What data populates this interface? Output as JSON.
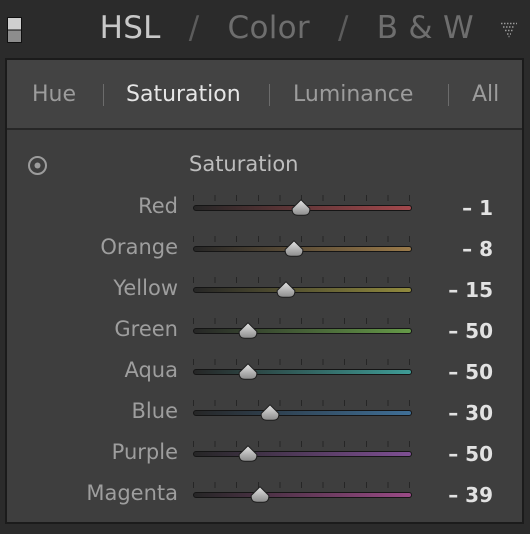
{
  "header": {
    "panel_switch_icon": "panel-switch-icon",
    "tabs": [
      "HSL",
      "Color",
      "B & W"
    ],
    "separator": "/",
    "collapse_icon": "triangle-down-icon"
  },
  "subtabs": [
    "Hue",
    "Saturation",
    "Luminance",
    "All"
  ],
  "active_subtab": "Saturation",
  "section": {
    "title": "Saturation",
    "target_icon": "targeted-adjustment-icon"
  },
  "sliders": [
    {
      "label": "Red",
      "value_text": "– 1",
      "value": -1,
      "color": "#a3484c"
    },
    {
      "label": "Orange",
      "value_text": "– 8",
      "value": -8,
      "color": "#9a7a4a"
    },
    {
      "label": "Yellow",
      "value_text": "– 15",
      "value": -15,
      "color": "#918a3e"
    },
    {
      "label": "Green",
      "value_text": "– 50",
      "value": -50,
      "color": "#659a48"
    },
    {
      "label": "Aqua",
      "value_text": "– 50",
      "value": -50,
      "color": "#3e9c96"
    },
    {
      "label": "Blue",
      "value_text": "– 30",
      "value": -30,
      "color": "#3f6f97"
    },
    {
      "label": "Purple",
      "value_text": "– 50",
      "value": -50,
      "color": "#7e4f93"
    },
    {
      "label": "Magenta",
      "value_text": "– 39",
      "value": -39,
      "color": "#9a4a86"
    }
  ],
  "range": [
    -100,
    100
  ]
}
